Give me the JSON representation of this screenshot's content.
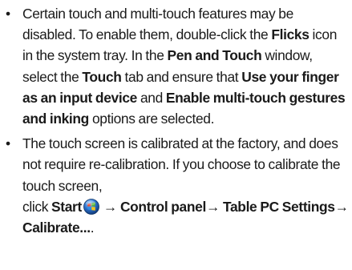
{
  "bullet_glyph": "•",
  "bullets": [
    {
      "segments": [
        {
          "text": "Certain touch and multi-touch features may be disabled. To enable them, double-click the ",
          "bold": false
        },
        {
          "text": "Flicks",
          "bold": true
        },
        {
          "text": " icon in the system tray. In the ",
          "bold": false
        },
        {
          "text": "Pen and Touch",
          "bold": true
        },
        {
          "text": " window, select the ",
          "bold": false
        },
        {
          "text": "Touch",
          "bold": true
        },
        {
          "text": " tab and ensure that ",
          "bold": false
        },
        {
          "text": "Use your finger as an input device",
          "bold": true
        },
        {
          "text": " and ",
          "bold": false
        },
        {
          "text": "Enable multi-touch gestures and inking",
          "bold": true
        },
        {
          "text": " options are selected.",
          "bold": false
        }
      ]
    },
    {
      "segments": [
        {
          "text": "The touch screen is calibrated at the factory, and does not require re-calibration. If you choose to calibrate the touch screen, ",
          "bold": false
        },
        {
          "text": "click ",
          "bold": false,
          "break_before": true
        },
        {
          "text": "Start",
          "bold": true
        },
        {
          "icon": "windows-start-orb-icon"
        },
        {
          "text": " → ",
          "bold": false
        },
        {
          "text": "Control panel",
          "bold": true
        },
        {
          "text": "→ ",
          "bold": false
        },
        {
          "text": "Table PC Settings",
          "bold": true
        },
        {
          "text": "→ ",
          "bold": false
        },
        {
          "text": "Calibrate...",
          "bold": true
        },
        {
          "text": ".",
          "bold": false
        }
      ]
    }
  ],
  "colors": {
    "text": "#1a1a1a",
    "orb_blue": "#2a6fc9",
    "orb_red": "#e4432b",
    "orb_green": "#58b431",
    "orb_yellow": "#f5c41b"
  }
}
